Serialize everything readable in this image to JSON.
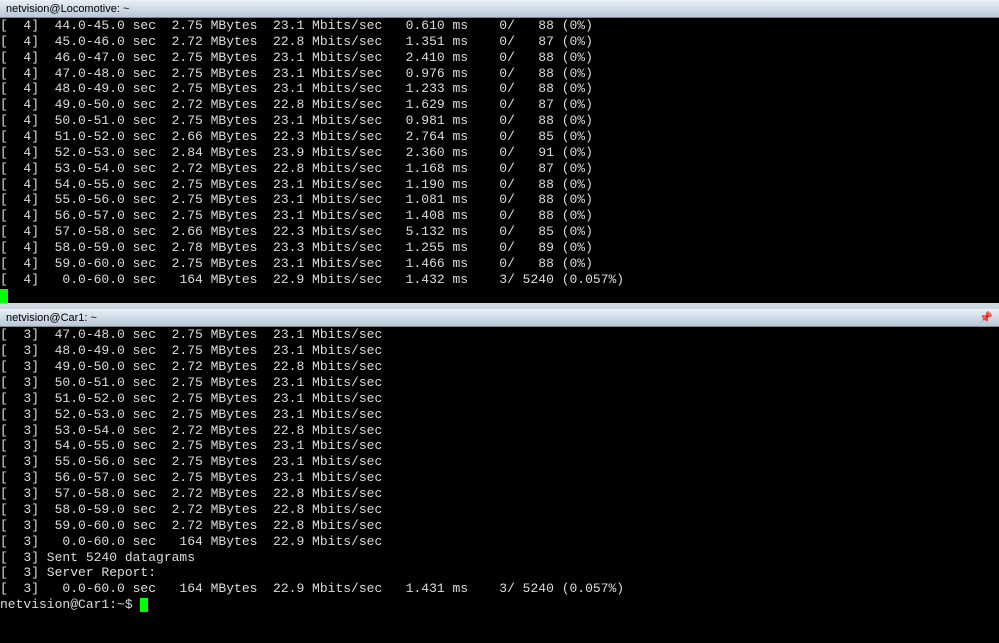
{
  "pane1": {
    "title": "netvision@Locomotive: ~",
    "rows": [
      "[  4]  44.0-45.0 sec  2.75 MBytes  23.1 Mbits/sec   0.610 ms    0/   88 (0%)",
      "[  4]  45.0-46.0 sec  2.72 MBytes  22.8 Mbits/sec   1.351 ms    0/   87 (0%)",
      "[  4]  46.0-47.0 sec  2.75 MBytes  23.1 Mbits/sec   2.410 ms    0/   88 (0%)",
      "[  4]  47.0-48.0 sec  2.75 MBytes  23.1 Mbits/sec   0.976 ms    0/   88 (0%)",
      "[  4]  48.0-49.0 sec  2.75 MBytes  23.1 Mbits/sec   1.233 ms    0/   88 (0%)",
      "[  4]  49.0-50.0 sec  2.72 MBytes  22.8 Mbits/sec   1.629 ms    0/   87 (0%)",
      "[  4]  50.0-51.0 sec  2.75 MBytes  23.1 Mbits/sec   0.981 ms    0/   88 (0%)",
      "[  4]  51.0-52.0 sec  2.66 MBytes  22.3 Mbits/sec   2.764 ms    0/   85 (0%)",
      "[  4]  52.0-53.0 sec  2.84 MBytes  23.9 Mbits/sec   2.360 ms    0/   91 (0%)",
      "[  4]  53.0-54.0 sec  2.72 MBytes  22.8 Mbits/sec   1.168 ms    0/   87 (0%)",
      "[  4]  54.0-55.0 sec  2.75 MBytes  23.1 Mbits/sec   1.190 ms    0/   88 (0%)",
      "[  4]  55.0-56.0 sec  2.75 MBytes  23.1 Mbits/sec   1.081 ms    0/   88 (0%)",
      "[  4]  56.0-57.0 sec  2.75 MBytes  23.1 Mbits/sec   1.408 ms    0/   88 (0%)",
      "[  4]  57.0-58.0 sec  2.66 MBytes  22.3 Mbits/sec   5.132 ms    0/   85 (0%)",
      "[  4]  58.0-59.0 sec  2.78 MBytes  23.3 Mbits/sec   1.255 ms    0/   89 (0%)",
      "[  4]  59.0-60.0 sec  2.75 MBytes  23.1 Mbits/sec   1.466 ms    0/   88 (0%)",
      "[  4]   0.0-60.0 sec   164 MBytes  22.9 Mbits/sec   1.432 ms    3/ 5240 (0.057%)"
    ],
    "cursor_prefix": ""
  },
  "pane2": {
    "title": "netvision@Car1: ~",
    "rows": [
      "[  3]  47.0-48.0 sec  2.75 MBytes  23.1 Mbits/sec",
      "[  3]  48.0-49.0 sec  2.75 MBytes  23.1 Mbits/sec",
      "[  3]  49.0-50.0 sec  2.72 MBytes  22.8 Mbits/sec",
      "[  3]  50.0-51.0 sec  2.75 MBytes  23.1 Mbits/sec",
      "[  3]  51.0-52.0 sec  2.75 MBytes  23.1 Mbits/sec",
      "[  3]  52.0-53.0 sec  2.75 MBytes  23.1 Mbits/sec",
      "[  3]  53.0-54.0 sec  2.72 MBytes  22.8 Mbits/sec",
      "[  3]  54.0-55.0 sec  2.75 MBytes  23.1 Mbits/sec",
      "[  3]  55.0-56.0 sec  2.75 MBytes  23.1 Mbits/sec",
      "[  3]  56.0-57.0 sec  2.75 MBytes  23.1 Mbits/sec",
      "[  3]  57.0-58.0 sec  2.72 MBytes  22.8 Mbits/sec",
      "[  3]  58.0-59.0 sec  2.72 MBytes  22.8 Mbits/sec",
      "[  3]  59.0-60.0 sec  2.72 MBytes  22.8 Mbits/sec",
      "[  3]   0.0-60.0 sec   164 MBytes  22.9 Mbits/sec",
      "[  3] Sent 5240 datagrams",
      "[  3] Server Report:",
      "[  3]   0.0-60.0 sec   164 MBytes  22.9 Mbits/sec   1.431 ms    3/ 5240 (0.057%)"
    ],
    "prompt": "netvision@Car1:~$ "
  }
}
